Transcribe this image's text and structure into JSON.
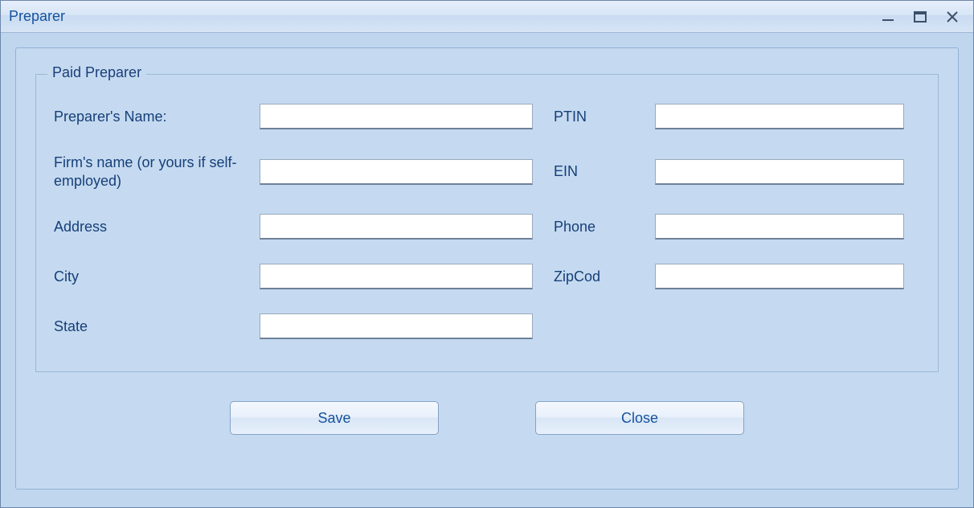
{
  "window": {
    "title": "Preparer"
  },
  "group": {
    "legend": "Paid Preparer"
  },
  "labels": {
    "preparer_name": "Preparer's Name:",
    "firm_name": "Firm's name (or yours if self-employed)",
    "address": "Address",
    "city": "City",
    "state": "State",
    "ptin": "PTIN",
    "ein": "EIN",
    "phone": "Phone",
    "zipcode": "ZipCod"
  },
  "values": {
    "preparer_name": "",
    "firm_name": "",
    "address": "",
    "city": "",
    "state": "",
    "ptin": "",
    "ein": "",
    "phone": "",
    "zipcode": ""
  },
  "buttons": {
    "save": "Save",
    "close": "Close"
  }
}
